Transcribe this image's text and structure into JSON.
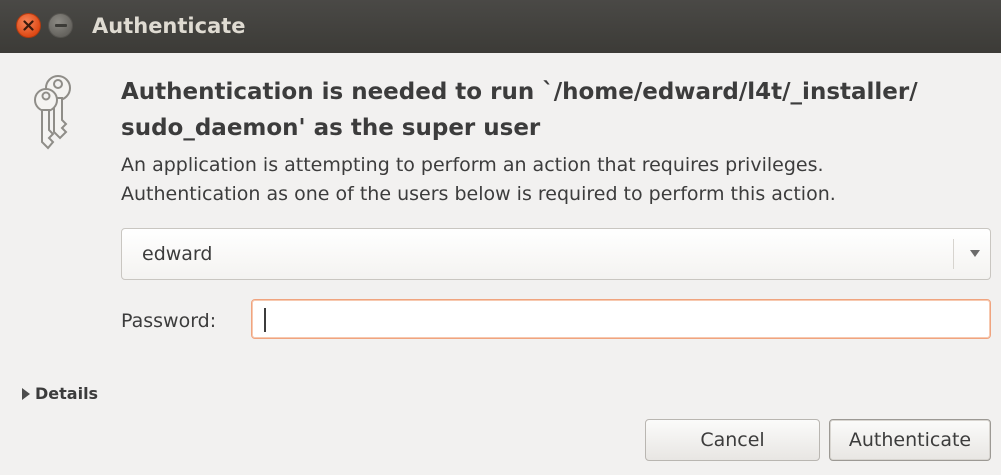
{
  "window": {
    "title": "Authenticate",
    "close_icon": "close-icon",
    "minimize_icon": "minimize-icon"
  },
  "icon": "keys-icon",
  "heading": "Authentication is needed to run `/home/edward/l4t/_installer/\nsudo_daemon' as the super user",
  "message": "An application is attempting to perform an action that requires privileges.\nAuthentication as one of the users below is required to perform this action.",
  "user_select": {
    "selected": "edward"
  },
  "password": {
    "label": "Password:",
    "value": ""
  },
  "details_label": "Details",
  "buttons": {
    "cancel": "Cancel",
    "authenticate": "Authenticate"
  },
  "colors": {
    "titlebar": "#3c3b37",
    "close_button": "#df4a16",
    "focus_border": "#f0a47f"
  }
}
